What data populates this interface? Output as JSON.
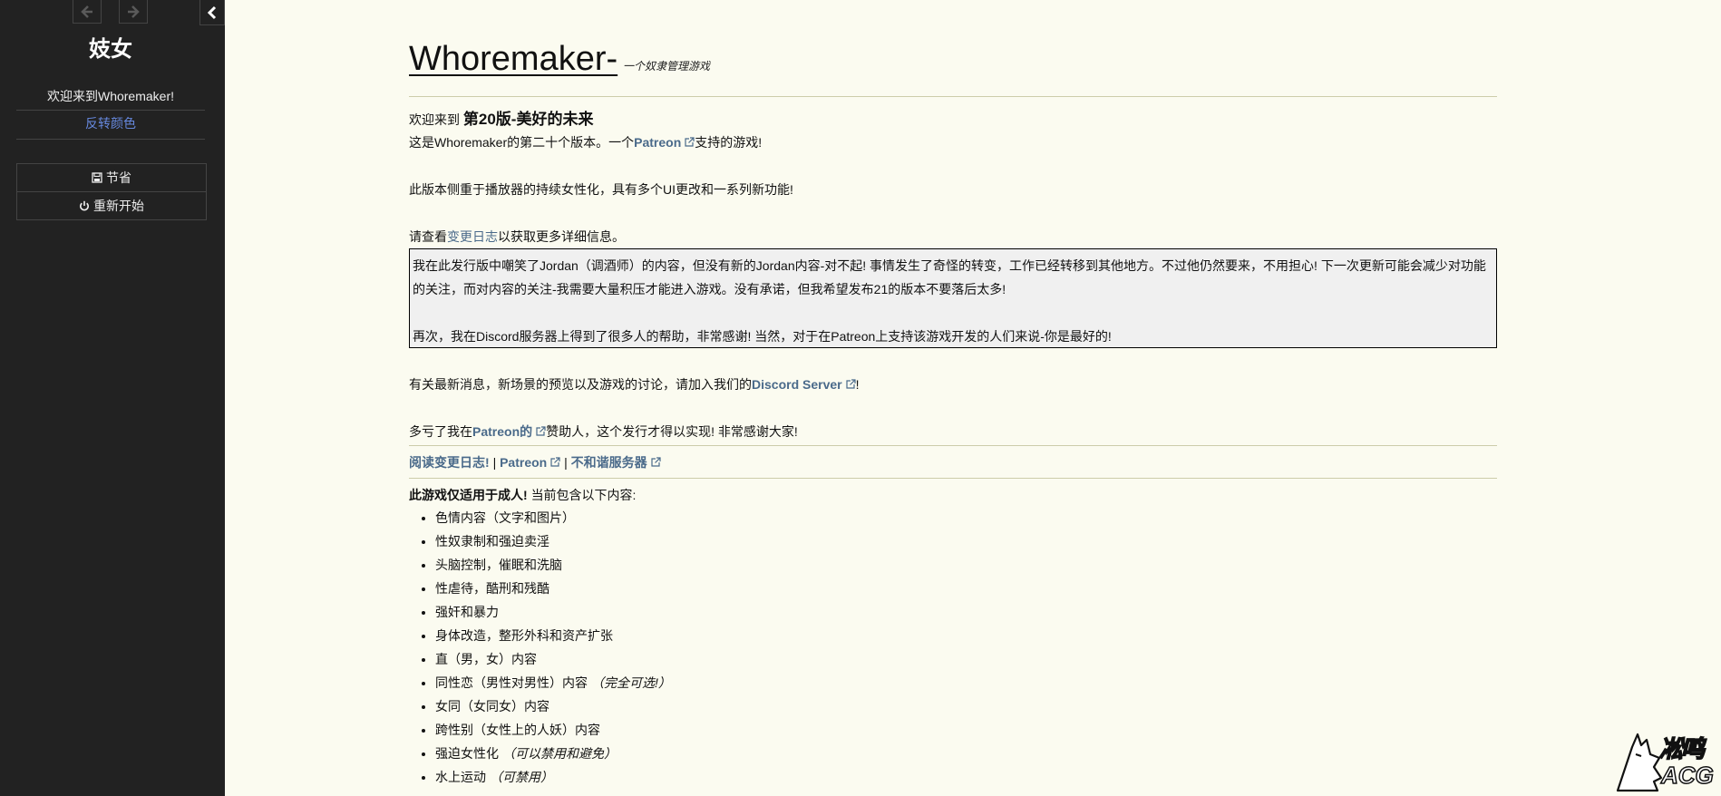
{
  "sidebar": {
    "title": "妓女",
    "welcome": "欢迎来到Whoremaker!",
    "invert_colors": "反转颜色",
    "menu": [
      {
        "label": "节省",
        "icon": "save-icon"
      },
      {
        "label": "重新开始",
        "icon": "power-icon"
      }
    ]
  },
  "header": {
    "title": "Whoremaker-",
    "subtitle": "一个奴隶管理游戏"
  },
  "intro": {
    "welcome_prefix": "欢迎来到",
    "version_name": "第20版-美好的未来",
    "line1_prefix": "这是Whoremaker的第二十个版本。一个",
    "line1_link": "Patreon",
    "line1_suffix": "支持的游戏!",
    "line2": "此版本侧重于播放器的持续女性化，具有多个UI更改和一系列新功能!",
    "line3_prefix": "请查看",
    "line3_link": "变更日志",
    "line3_suffix": "以获取更多详细信息。"
  },
  "notice": {
    "para1": "我在此发行版中嘲笑了Jordan（调酒师）的内容，但没有新的Jordan内容-对不起! 事情发生了奇怪的转变，工作已经转移到其他地方。不过他仍然要来，不用担心! 下一次更新可能会减少对功能的关注，而对内容的关注-我需要大量积压才能进入游戏。没有承诺，但我希望发布21的版本不要落后太多!",
    "para2": "再次，我在Discord服务器上得到了很多人的帮助，非常感谢! 当然，对于在Patreon上支持该游戏开发的人们来说-你是最好的!"
  },
  "discord_line": {
    "prefix": "有关最新消息，新场景的预览以及游戏的讨论，请加入我们的",
    "link": "Discord Server",
    "suffix": "!"
  },
  "thanks_line": {
    "prefix": "多亏了我在",
    "link": "Patreon的",
    "suffix": "赞助人，这个发行才得以实现! 非常感谢大家!"
  },
  "links_bar": {
    "changelog": "阅读变更日志!",
    "sep": "|",
    "patreon": "Patreon",
    "discord": "不和谐服务器"
  },
  "content": {
    "warning_bold": "此游戏仅适用于成人!",
    "warning_rest": "当前包含以下内容:",
    "items": [
      {
        "text": "色情内容（文字和图片）",
        "note": ""
      },
      {
        "text": "性奴隶制和强迫卖淫",
        "note": ""
      },
      {
        "text": "头脑控制，催眠和洗脑",
        "note": ""
      },
      {
        "text": "性虐待，酷刑和残酷",
        "note": ""
      },
      {
        "text": "强奸和暴力",
        "note": ""
      },
      {
        "text": "身体改造，整形外科和资产扩张",
        "note": ""
      },
      {
        "text": "直（男，女）内容",
        "note": ""
      },
      {
        "text": "同性恋（男性对男性）内容",
        "note": "（完全可选!）"
      },
      {
        "text": "女同（女同女）内容",
        "note": ""
      },
      {
        "text": "跨性别（女性上的人妖）内容",
        "note": ""
      },
      {
        "text": "强迫女性化",
        "note": "（可以禁用和避免）"
      },
      {
        "text": "水上运动",
        "note": "（可禁用）"
      }
    ]
  },
  "watermark": {
    "text_top": "凇鸣",
    "text_bottom": "ACG"
  }
}
